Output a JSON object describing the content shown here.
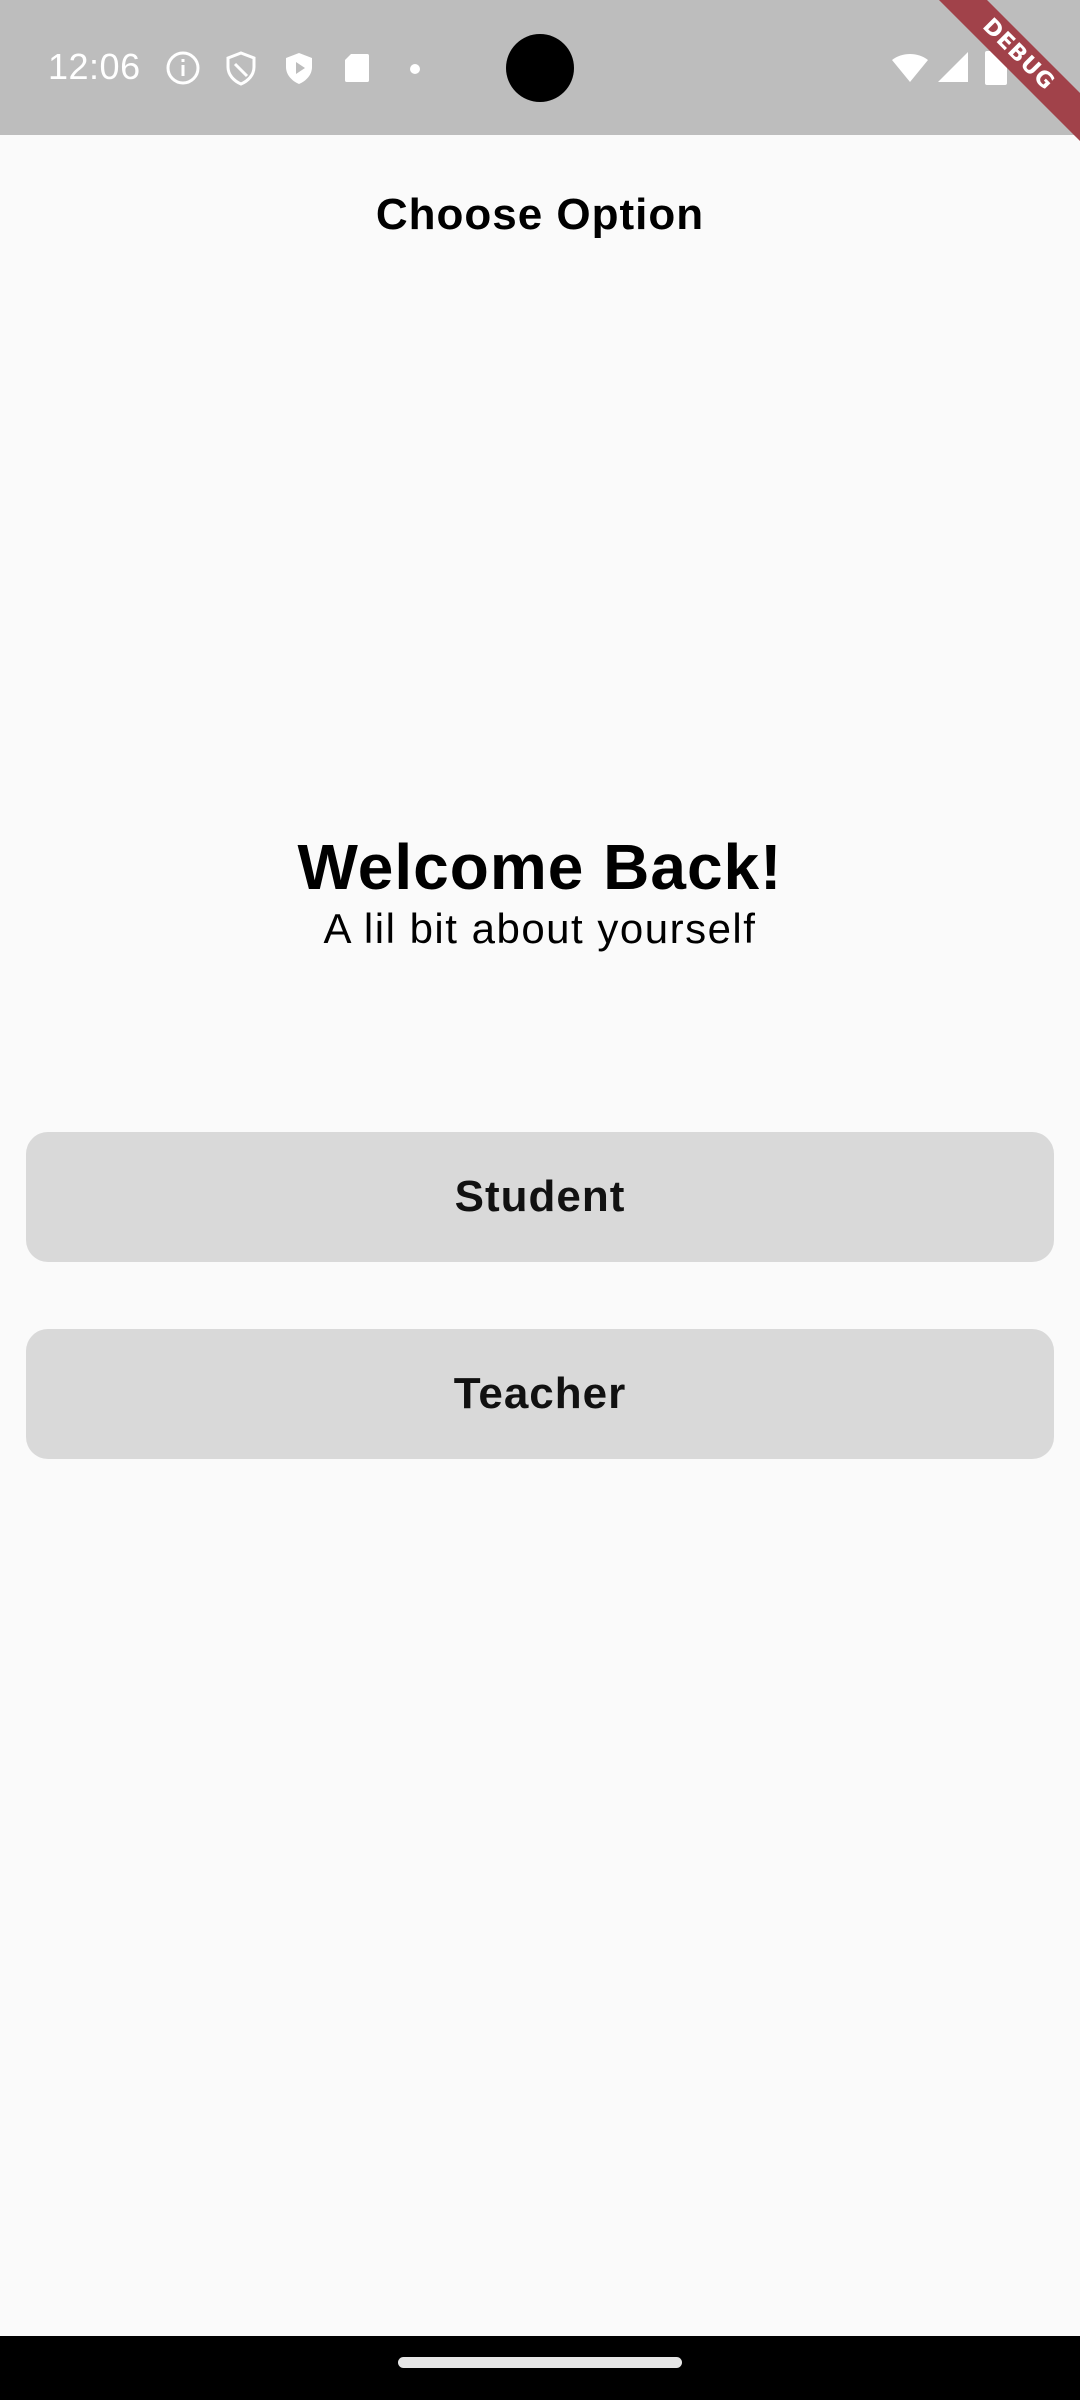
{
  "status_bar": {
    "time": "12:06",
    "left_icons": [
      "info-icon",
      "shield-icon",
      "play-protect-icon",
      "sd-card-icon",
      "dot-icon"
    ],
    "right_icons": [
      "wifi-icon",
      "signal-icon",
      "battery-icon"
    ],
    "background_color": "#bdbdbd"
  },
  "debug_banner": {
    "label": "DEBUG",
    "color": "#a1424a"
  },
  "app_bar": {
    "title": "Choose Option"
  },
  "welcome": {
    "title": "Welcome Back!",
    "subtitle": "A lil bit about yourself"
  },
  "options": {
    "student_label": "Student",
    "teacher_label": "Teacher",
    "button_color": "#d9d9d9"
  }
}
